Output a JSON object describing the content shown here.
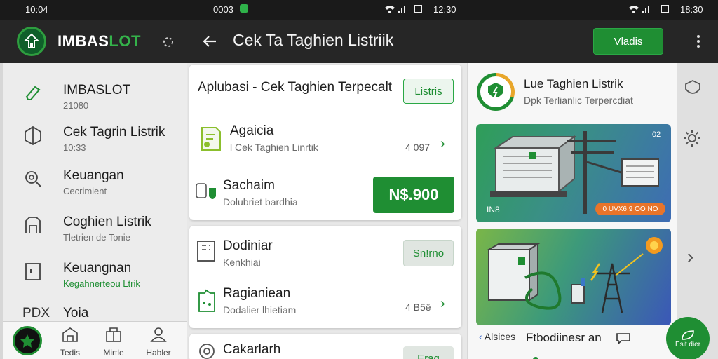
{
  "status": {
    "left_time": "10:04",
    "center_text": "0003",
    "time_mid": "12:30",
    "time_right": "18:30"
  },
  "app": {
    "name_prefix": "IMBAS",
    "name_suffix": "LOT",
    "title": "Cek Ta Taghien Listriik",
    "top_button": "Vladis"
  },
  "sidebar": {
    "items": [
      {
        "title": "IMBASLOT",
        "sub": "21080",
        "icon": "lightning-icon"
      },
      {
        "title": "Cek Tagrin Listrik",
        "sub": "10:33",
        "icon": "cube-icon"
      },
      {
        "title": "Keuangan",
        "sub": "Cecrimient",
        "icon": "search-settings-icon"
      },
      {
        "title": "Coghien Listrik",
        "sub": "Tletrien de Tonie",
        "icon": "cabinet-icon"
      },
      {
        "title": "Keuangnan",
        "sub": "Kegahnerteou Ltrik",
        "icon": "door-icon"
      },
      {
        "title": "Yoia",
        "sub": "",
        "icon": "pdx-icon",
        "prefix": "PDX"
      }
    ]
  },
  "bottom_nav": {
    "items": [
      {
        "label": "Tedis",
        "icon": "home-icon"
      },
      {
        "label": "Mirtle",
        "icon": "grid-icon"
      },
      {
        "label": "Habler",
        "icon": "user-icon"
      }
    ]
  },
  "main": {
    "header_title": "Aplubasi - Cek Taghien Terpecalt",
    "header_chip": "Listris",
    "card1": [
      {
        "title": "Agaicia",
        "sub": "l Cek Taghien Linrtik",
        "value": "4 097",
        "icon": "document-icon"
      },
      {
        "title": "Sachaim",
        "sub": "Dolubriet bardhia",
        "value": "N$.900",
        "icon": "key-shield-icon"
      }
    ],
    "card2": [
      {
        "title": "Dodiniar",
        "sub": "Kenkhiai",
        "chip": "Sn!rno",
        "icon": "panel-icon"
      },
      {
        "title": "Ragianiean",
        "sub": "Dodalier lhietiam",
        "value": "4 B5ë",
        "icon": "invoice-icon"
      }
    ],
    "card3": [
      {
        "title": "Cakarlarh",
        "chip": "Erag",
        "icon": "circle-target-icon"
      }
    ]
  },
  "right": {
    "title": "Lue Taghien Listrik",
    "sub": "Dpk Terlianlic Terpercdiat",
    "img1_tag": "02",
    "img1_badge": "0 UVX6 9 OO NO",
    "img1_corner": "IN8",
    "bottom_left": "Alsices",
    "bottom_main": "Ftbodiinesr an"
  },
  "fab": {
    "label": "Esit dier"
  },
  "colors": {
    "accent": "#1f8e33",
    "appbar": "#262626",
    "orange": "#e8742a"
  }
}
